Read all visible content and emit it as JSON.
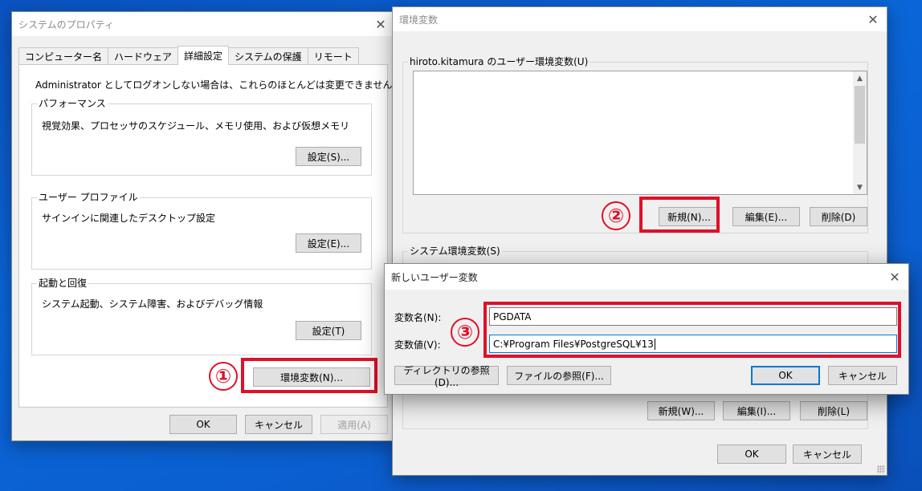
{
  "system_properties": {
    "title": "システムのプロパティ",
    "tabs": [
      "コンピューター名",
      "ハードウェア",
      "詳細設定",
      "システムの保護",
      "リモート"
    ],
    "admin_note": "Administrator としてログオンしない場合は、これらのほとんどは変更できません。",
    "performance": {
      "legend": "パフォーマンス",
      "desc": "視覚効果、プロセッサのスケジュール、メモリ使用、および仮想メモリ",
      "button": "設定(S)..."
    },
    "user_profile": {
      "legend": "ユーザー プロファイル",
      "desc": "サインインに関連したデスクトップ設定",
      "button": "設定(E)..."
    },
    "startup_recovery": {
      "legend": "起動と回復",
      "desc": "システム起動、システム障害、およびデバッグ情報",
      "button": "設定(T)"
    },
    "env_button": "環境変数(N)...",
    "ok": "OK",
    "cancel": "キャンセル",
    "apply": "適用(A)"
  },
  "env_vars": {
    "title": "環境変数",
    "user_section": "hiroto.kitamura のユーザー環境変数(U)",
    "new_user": "新規(N)...",
    "edit_user": "編集(E)...",
    "delete_user": "削除(D)",
    "system_section": "システム環境変数(S)",
    "new_system": "新規(W)...",
    "edit_system": "編集(I)...",
    "delete_system": "削除(L)",
    "ok": "OK",
    "cancel": "キャンセル"
  },
  "new_user_var": {
    "title": "新しいユーザー変数",
    "name_label": "変数名(N):",
    "name_value": "PGDATA",
    "value_label": "変数値(V):",
    "value_value": "C:¥Program Files¥PostgreSQL¥13",
    "browse_dir": "ディレクトリの参照(D)...",
    "browse_file": "ファイルの参照(F)...",
    "ok": "OK",
    "cancel": "キャンセル"
  },
  "markers": [
    "①",
    "②",
    "③"
  ],
  "colors": {
    "highlight": "#e0102a",
    "focus": "#0078d7"
  }
}
